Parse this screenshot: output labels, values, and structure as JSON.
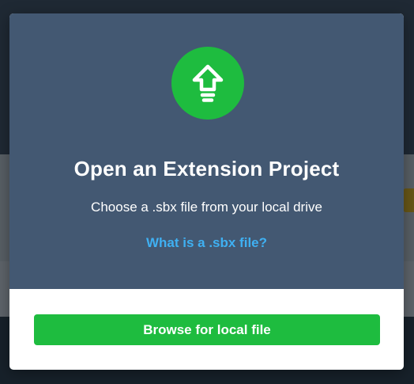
{
  "modal": {
    "title": "Open an Extension Project",
    "subtitle": "Choose a .sbx file from your local drive",
    "help_link": "What is a .sbx file?",
    "browse_button": "Browse for local file",
    "icon": "upload-arrow-icon"
  },
  "colors": {
    "header_bg": "#435872",
    "accent_green": "#1ebc3f",
    "link_blue": "#3fb0f2"
  }
}
